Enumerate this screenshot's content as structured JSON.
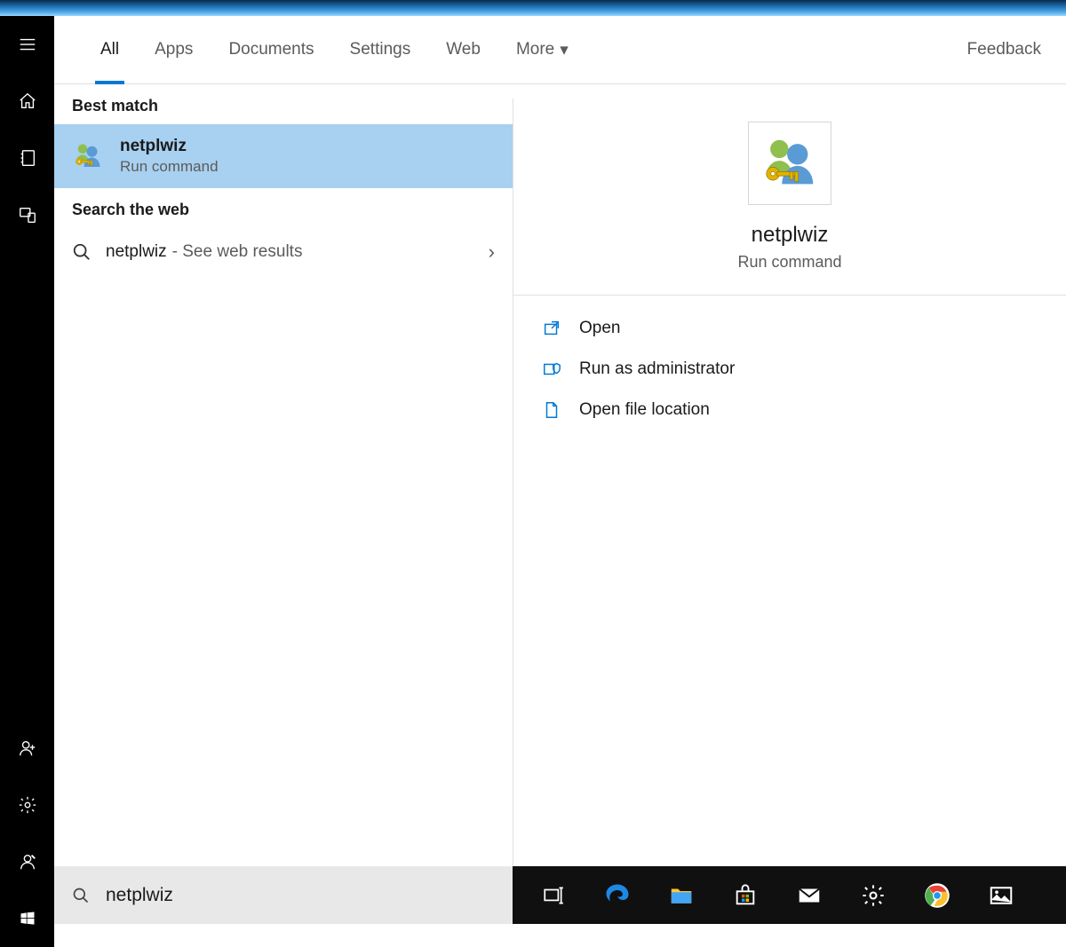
{
  "tabs": {
    "items": [
      "All",
      "Apps",
      "Documents",
      "Settings",
      "Web",
      "More"
    ],
    "active": "All",
    "feedback": "Feedback"
  },
  "sections": {
    "best_match": "Best match",
    "search_web": "Search the web"
  },
  "best_match_result": {
    "title": "netplwiz",
    "subtitle": "Run command"
  },
  "web_result": {
    "query": "netplwiz",
    "hint": "- See web results"
  },
  "preview": {
    "title": "netplwiz",
    "subtitle": "Run command",
    "actions": {
      "open": "Open",
      "run_admin": "Run as administrator",
      "open_loc": "Open file location"
    }
  },
  "search_input": {
    "value": "netplwiz"
  }
}
